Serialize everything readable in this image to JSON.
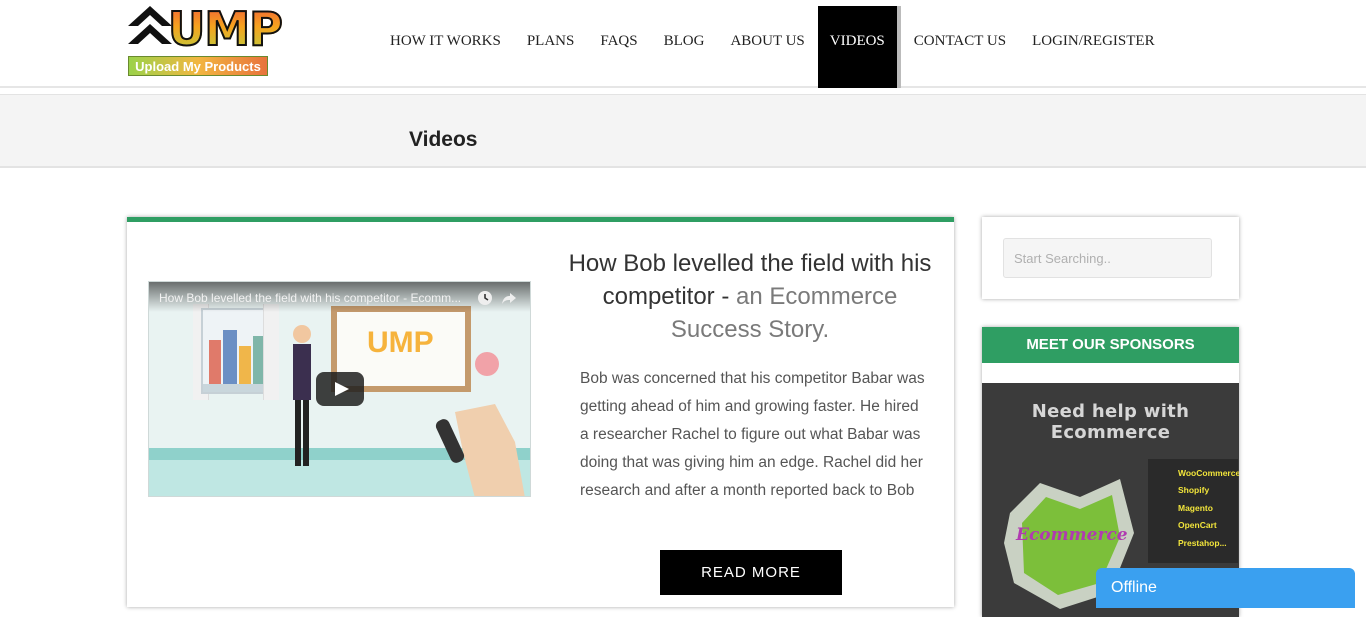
{
  "header": {
    "logo_text": "UMP",
    "logo_tagline": "Upload My Products",
    "nav": [
      {
        "label": "HOW IT WORKS"
      },
      {
        "label": "PLANS"
      },
      {
        "label": "FAQS"
      },
      {
        "label": "BLOG"
      },
      {
        "label": "ABOUT US"
      },
      {
        "label": "VIDEOS",
        "active": true
      },
      {
        "label": "CONTACT US"
      },
      {
        "label": "LOGIN/REGISTER"
      }
    ]
  },
  "page_title": "Videos",
  "post": {
    "video_title": "How Bob levelled the field with his competitor - Ecomm...",
    "video_board_text": "UMP",
    "heading_main": "How Bob levelled the field with his competitor - ",
    "heading_accent": "an Ecommerce Success Story.",
    "excerpt": "Bob was concerned that his competitor Babar was getting ahead of him and growing faster. He hired a researcher Rachel to figure out what Babar was doing that was giving him an edge. Rachel did her research and after a month reported back to Bob",
    "read_more_label": "READ MORE"
  },
  "sidebar": {
    "search_placeholder": "Start Searching..",
    "sponsors_title": "MEET OUR SPONSORS",
    "banner": {
      "title": "Need help with Ecommerce",
      "word": "Ecommerce",
      "platforms": [
        "WooCommerce",
        "Shopify",
        "Magento",
        "OpenCart",
        "Prestahop..."
      ]
    }
  },
  "chat": {
    "label": "Offline"
  },
  "colors": {
    "accent_green": "#2f9e63",
    "chat_blue": "#3aa0f0",
    "nav_active_bg": "#000000"
  },
  "icons": {
    "video": [
      "watch-later-icon",
      "share-icon",
      "play-icon"
    ]
  }
}
